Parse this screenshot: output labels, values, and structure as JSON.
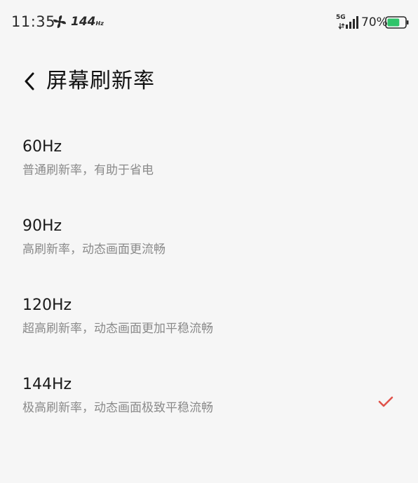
{
  "status_bar": {
    "time": "11:35",
    "refresh_rate": "144",
    "refresh_unit": "Hz",
    "network_type": "5G",
    "battery_percent": "70%",
    "battery_level": 0.7,
    "battery_color": "#2fc46a"
  },
  "header": {
    "title": "屏幕刷新率"
  },
  "options": [
    {
      "title": "60Hz",
      "description": "普通刷新率，有助于省电",
      "selected": false
    },
    {
      "title": "90Hz",
      "description": "高刷新率，动态画面更流畅",
      "selected": false
    },
    {
      "title": "120Hz",
      "description": "超高刷新率，动态画面更加平稳流畅",
      "selected": false
    },
    {
      "title": "144Hz",
      "description": "极高刷新率，动态画面极致平稳流畅",
      "selected": true
    }
  ],
  "colors": {
    "background": "#f6f6f6",
    "check_accent": "#e0524a",
    "secondary_text": "#8a8a8a"
  },
  "icons": {
    "back": "chevron-left-icon",
    "check": "checkmark-icon",
    "fan": "fan-icon",
    "signal": "signal-icon",
    "battery": "battery-icon"
  }
}
